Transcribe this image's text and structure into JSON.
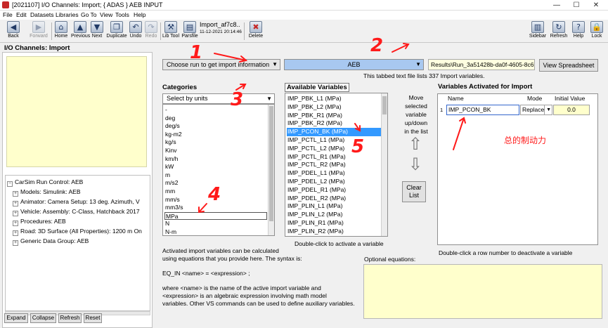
{
  "window": {
    "title": "[2021107] I/O Channels: Import; { ADAS } AEB INPUT",
    "minimize_glyph": "—",
    "maximize_glyph": "☐",
    "close_glyph": "✕"
  },
  "menu": [
    "File",
    "Edit",
    "Datasets",
    "Libraries",
    "Go To",
    "View",
    "Tools",
    "Help"
  ],
  "toolbar": {
    "buttons": [
      {
        "label": "Back",
        "glyph": "◀",
        "disabled": false
      },
      {
        "label": "Forward",
        "glyph": "▶",
        "disabled": true
      },
      {
        "label": "Home",
        "glyph": "⌂",
        "disabled": false
      },
      {
        "label": "Previous",
        "glyph": "▲",
        "disabled": false
      },
      {
        "label": "Next",
        "glyph": "▼",
        "disabled": false
      },
      {
        "label": "Duplicate",
        "glyph": "❐",
        "disabled": false
      },
      {
        "label": "Undo",
        "glyph": "↶",
        "disabled": false
      },
      {
        "label": "Redo",
        "glyph": "↷",
        "disabled": true
      },
      {
        "label": "Lib Tool",
        "glyph": "⚒",
        "disabled": false
      },
      {
        "label": "Parsfile",
        "glyph": "▤",
        "disabled": false
      },
      {
        "label": "Delete",
        "glyph": "✖",
        "disabled": false
      },
      {
        "label": "Sidebar",
        "glyph": "▥",
        "disabled": false
      },
      {
        "label": "Refresh",
        "glyph": "↻",
        "disabled": false
      },
      {
        "label": "Help",
        "glyph": "?",
        "disabled": false
      },
      {
        "label": "Lock",
        "glyph": "🔒",
        "disabled": false
      }
    ],
    "dataset_name": "Import_af7c8...",
    "dataset_date": "11-12-2021 20:14:46"
  },
  "left_panel": {
    "title": "I/O Channels: Import",
    "tree": [
      "CarSim Run Control: AEB",
      "Models: Simulink: AEB",
      "Animator: Camera Setup: 13 deg. Azimuth, V",
      "Vehicle: Assembly: C-Class, Hatchback 2017",
      "Procedures: AEB",
      "Road: 3D Surface (All Properties): 1200 m On",
      "Generic Data Group: AEB"
    ],
    "buttons": [
      "Expand",
      "Collapse",
      "Refresh",
      "Reset"
    ]
  },
  "top_controls": {
    "run_combo": "Choose run to get import information",
    "aeb_combo": "AEB",
    "results_path": "Results\\Run_3a51428b-da0f-4605-8c6",
    "view_spreadsheet": "View Spreadsheet",
    "info_text": "This tabbed text file lists 337 Import variables."
  },
  "categories": {
    "heading": "Categories",
    "combo": "Select by units",
    "items": [
      "-",
      "deg",
      "deg/s",
      "kg-m2",
      "kg/s",
      "Kinv",
      "km/h",
      "kW",
      "m",
      "m/s2",
      "mm",
      "mm/s",
      "mm3/s",
      "MPa",
      "N",
      "N-m"
    ],
    "boxed_item": "MPa"
  },
  "available": {
    "heading": "Available Variables",
    "items": [
      "IMP_PBK_L1 (MPa)",
      "IMP_PBK_L2 (MPa)",
      "IMP_PBK_R1 (MPa)",
      "IMP_PBK_R2 (MPa)",
      "IMP_PCON_BK (MPa)",
      "IMP_PCTL_L1 (MPa)",
      "IMP_PCTL_L2 (MPa)",
      "IMP_PCTL_R1 (MPa)",
      "IMP_PCTL_R2 (MPa)",
      "IMP_PDEL_L1 (MPa)",
      "IMP_PDEL_L2 (MPa)",
      "IMP_PDEL_R1 (MPa)",
      "IMP_PDEL_R2 (MPa)",
      "IMP_PLIN_L1 (MPa)",
      "IMP_PLIN_L2 (MPa)",
      "IMP_PLIN_R1 (MPa)",
      "IMP_PLIN_R2 (MPa)"
    ],
    "selected_item": "IMP_PCON_BK (MPa)",
    "hint": "Double-click to activate a variable"
  },
  "move_controls": {
    "label_lines": [
      "Move",
      "selected",
      "variable",
      "up/down",
      "in the list"
    ],
    "up_glyph": "⇧",
    "down_glyph": "⇩",
    "clear_line1": "Clear",
    "clear_line2": "List"
  },
  "activated": {
    "heading": "Variables Activated for Import",
    "columns": [
      "Name",
      "Mode",
      "Initial Value"
    ],
    "rows": [
      {
        "index": "1",
        "name": "IMP_PCON_BK",
        "mode": "Replace",
        "value": "0.0"
      }
    ],
    "hint": "Double-click a row number to deactivate a variable"
  },
  "equations": {
    "help_lines": [
      "Activated import variables can be calculated",
      "using equations that you provide here. The syntax is:",
      "",
      "EQ_IN <name> = <expression> ;",
      "",
      "where <name> is the name of the active import variable and",
      "<expression> is an algebraic expression involving math model",
      "variables. Other VS commands can be used to define auxiliary variables."
    ],
    "optional_label": "Optional equations:"
  },
  "annotations": {
    "numbers": [
      "1",
      "2",
      "3",
      "4",
      "5"
    ],
    "chinese_note": "总的制动力",
    "color": "#ff1a1a"
  }
}
